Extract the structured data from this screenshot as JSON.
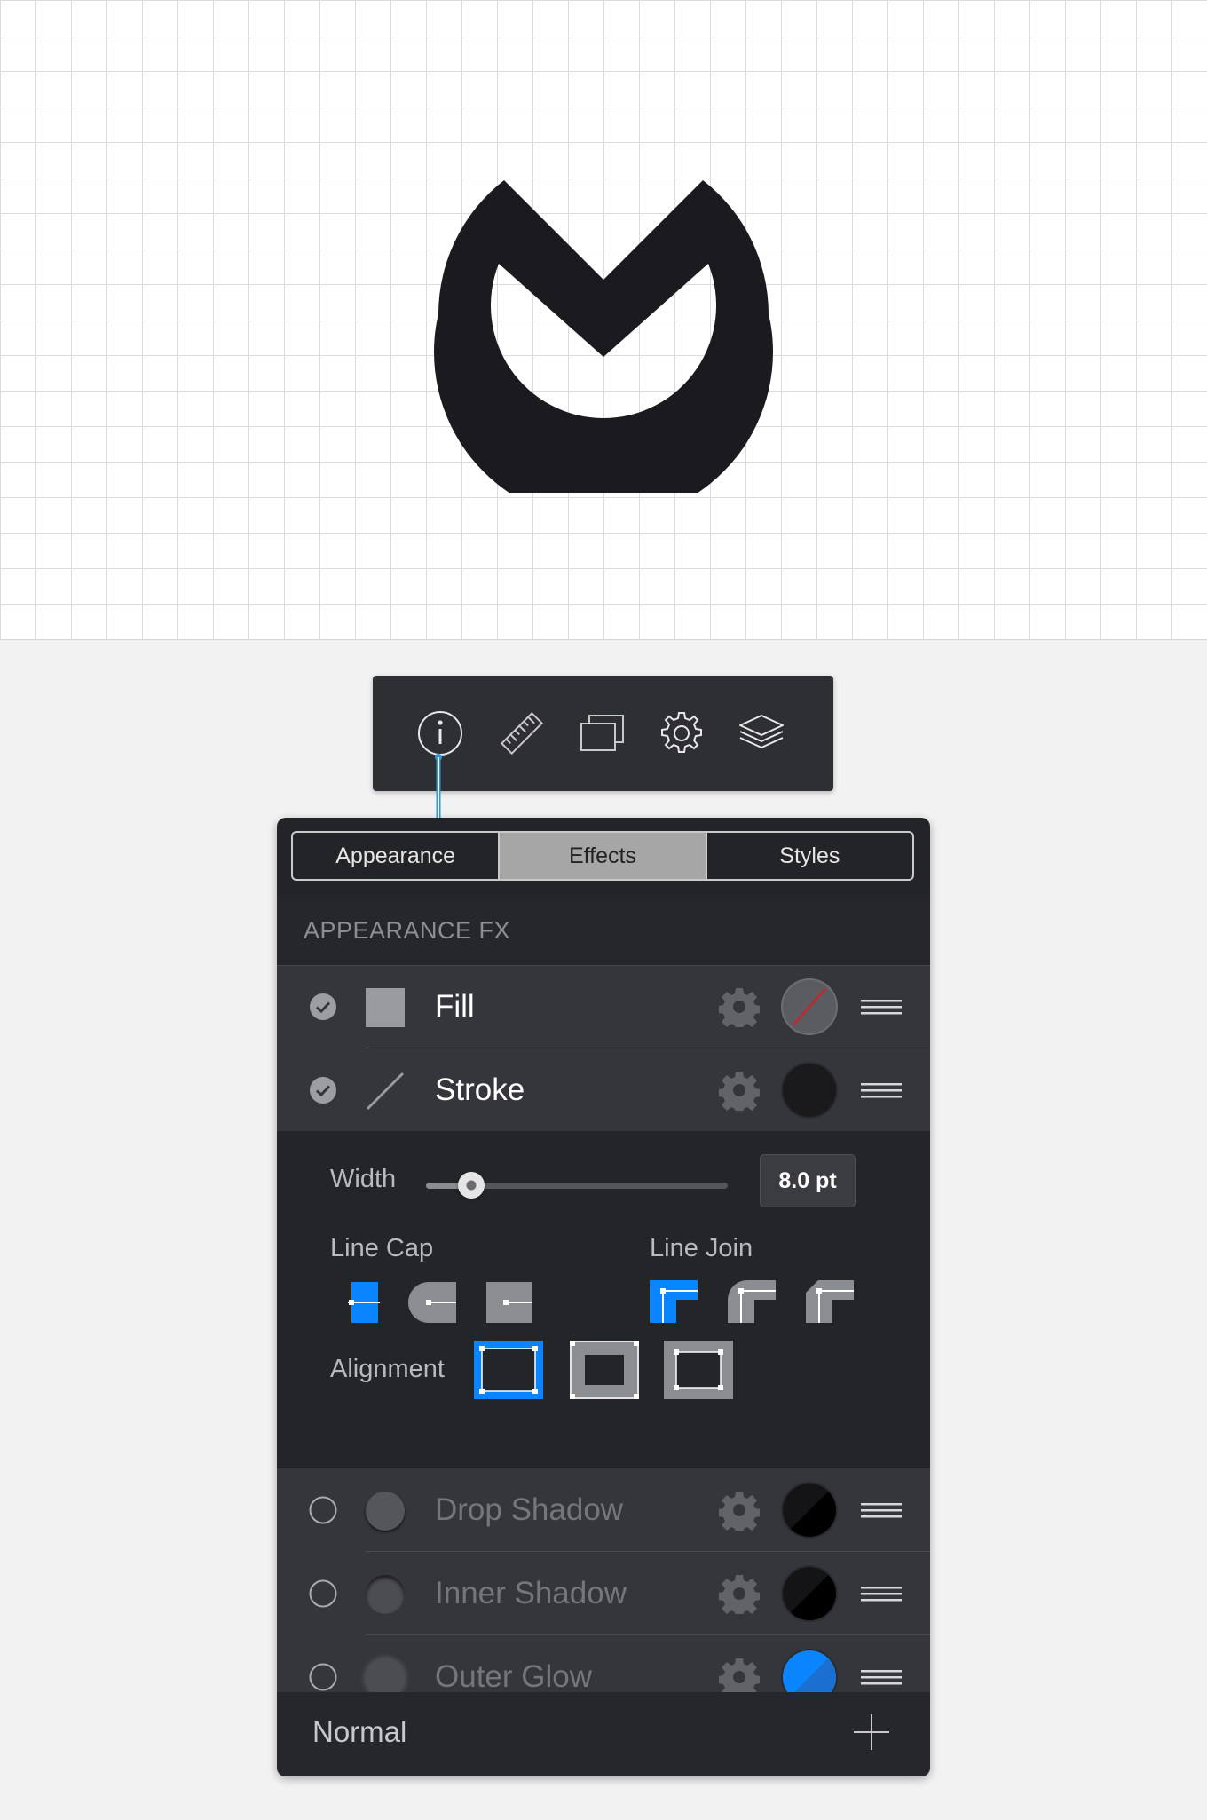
{
  "canvas": {
    "grid": true,
    "logo": "m-logo-icon"
  },
  "toolbar": {
    "icons": [
      "info-icon",
      "ruler-icon",
      "artboards-icon",
      "gear-icon",
      "layers-icon"
    ],
    "active": "info-icon",
    "accent": "#2a9bd8"
  },
  "tabs": [
    {
      "label": "Appearance",
      "active": false
    },
    {
      "label": "Effects",
      "active": true
    },
    {
      "label": "Styles",
      "active": false
    }
  ],
  "section_title": "APPEARANCE FX",
  "effects": [
    {
      "label": "Fill",
      "enabled": true,
      "color": "none"
    },
    {
      "label": "Stroke",
      "enabled": true,
      "color": "#1a1a1d"
    },
    {
      "label": "Drop Shadow",
      "enabled": false,
      "color": "#000000"
    },
    {
      "label": "Inner Shadow",
      "enabled": false,
      "color": "#000000"
    },
    {
      "label": "Outer Glow",
      "enabled": false,
      "color": "#0a84ff"
    }
  ],
  "stroke_options": {
    "width_label": "Width",
    "width_value": "8.0 pt",
    "width_slider_fraction": 0.15,
    "line_cap_label": "Line Cap",
    "line_cap_selected": "butt",
    "line_join_label": "Line Join",
    "line_join_selected": "miter",
    "alignment_label": "Alignment",
    "alignment_selected": "inside",
    "accent": "#0a84ff"
  },
  "footer": {
    "blend_mode": "Normal"
  }
}
